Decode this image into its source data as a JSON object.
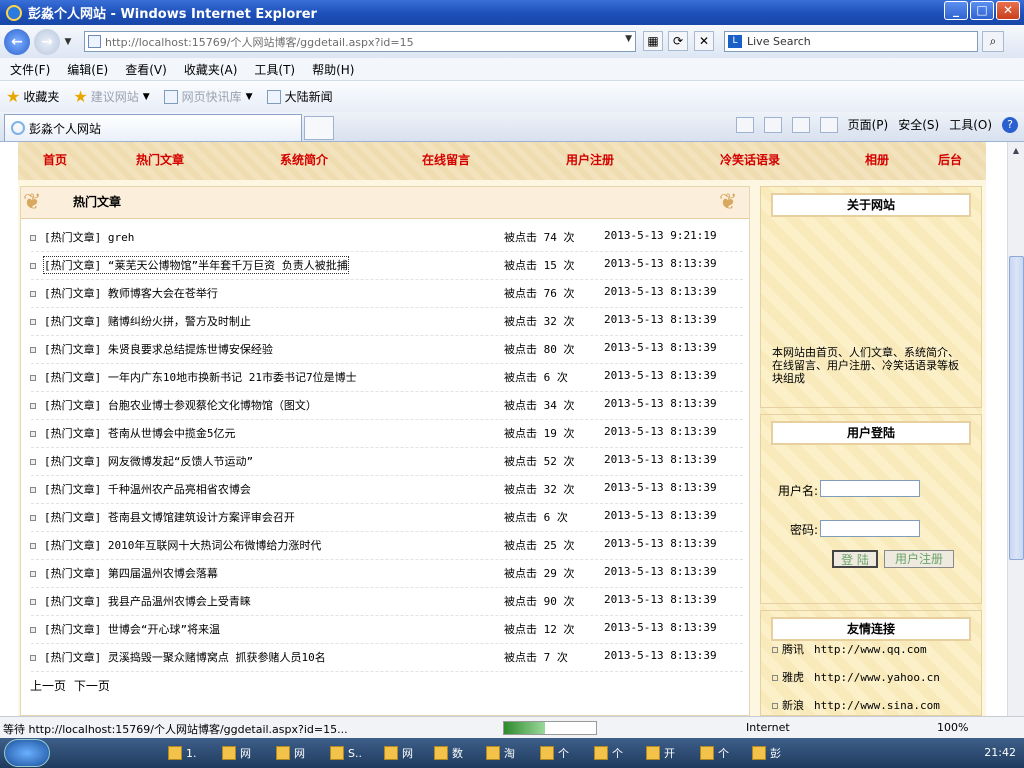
{
  "window": {
    "title": "彭淼个人网站 - Windows Internet Explorer",
    "controls": [
      "_",
      "□",
      "✕"
    ]
  },
  "address": {
    "url": "http://localhost:15769/个人网站博客/ggdetail.aspx?id=15",
    "search_placeholder": "Live Search"
  },
  "menu": [
    "文件(F)",
    "编辑(E)",
    "查看(V)",
    "收藏夹(A)",
    "工具(T)",
    "帮助(H)"
  ],
  "favbar": {
    "favorites": "收藏夹",
    "suggested": "建议网站",
    "slices": "网页快讯库",
    "news": "大陆新闻"
  },
  "tab": {
    "title": "彭淼个人网站"
  },
  "commands": {
    "page": "页面(P)",
    "safety": "安全(S)",
    "tools": "工具(O)"
  },
  "site_nav": [
    "首页",
    "热门文章",
    "系统简介",
    "在线留言",
    "用户注册",
    "冷笑话语录",
    "相册",
    "后台"
  ],
  "hot": {
    "heading": "热门文章",
    "items": [
      {
        "title": "[热门文章] greh",
        "clicks": "被点击 74 次",
        "date": "2013-5-13 9:21:19"
      },
      {
        "title": "[热门文章] “莱芜天公博物馆”半年套千万巨资 负责人被批捕",
        "clicks": "被点击 15 次",
        "date": "2013-5-13 8:13:39"
      },
      {
        "title": "[热门文章] 教师博客大会在苍举行",
        "clicks": "被点击 76 次",
        "date": "2013-5-13 8:13:39"
      },
      {
        "title": "[热门文章] 赌博纠纷火拼，警方及时制止",
        "clicks": "被点击 32 次",
        "date": "2013-5-13 8:13:39"
      },
      {
        "title": "[热门文章] 朱贤良要求总结提炼世博安保经验",
        "clicks": "被点击 80 次",
        "date": "2013-5-13 8:13:39"
      },
      {
        "title": "[热门文章] 一年内广东10地市换新书记 21市委书记7位是博士",
        "clicks": "被点击 6 次",
        "date": "2013-5-13 8:13:39"
      },
      {
        "title": "[热门文章] 台胞农业博士参观蔡伦文化博物馆（图文）",
        "clicks": "被点击 34 次",
        "date": "2013-5-13 8:13:39"
      },
      {
        "title": "[热门文章] 苍南从世博会中揽金5亿元",
        "clicks": "被点击 19 次",
        "date": "2013-5-13 8:13:39"
      },
      {
        "title": "[热门文章] 网友微博发起“反馈人节运动”",
        "clicks": "被点击 52 次",
        "date": "2013-5-13 8:13:39"
      },
      {
        "title": "[热门文章] 千种温州农产品亮相省农博会",
        "clicks": "被点击 32 次",
        "date": "2013-5-13 8:13:39"
      },
      {
        "title": "[热门文章] 苍南县文博馆建筑设计方案评审会召开",
        "clicks": "被点击 6 次",
        "date": "2013-5-13 8:13:39"
      },
      {
        "title": "[热门文章] 2010年互联网十大热词公布微博给力涨时代",
        "clicks": "被点击 25 次",
        "date": "2013-5-13 8:13:39"
      },
      {
        "title": "[热门文章] 第四届温州农博会落幕",
        "clicks": "被点击 29 次",
        "date": "2013-5-13 8:13:39"
      },
      {
        "title": "[热门文章] 我县产品温州农博会上受青睐",
        "clicks": "被点击 90 次",
        "date": "2013-5-13 8:13:39"
      },
      {
        "title": "[热门文章] 世博会“开心球”将来温",
        "clicks": "被点击 12 次",
        "date": "2013-5-13 8:13:39"
      },
      {
        "title": "[热门文章] 灵溪捣毁一聚众赌博窝点 抓获参赌人员10名",
        "clicks": "被点击 7 次",
        "date": "2013-5-13 8:13:39"
      }
    ],
    "prev": "上一页",
    "next": "下一页"
  },
  "sidebar": {
    "about_title": "关于网站",
    "about_text": "本网站由首页、人们文章、系统简介、在线留言、用户注册、冷笑话语录等板块组成",
    "login_title": "用户登陆",
    "username_label": "用户名:",
    "password_label": "密码:",
    "login_btn": "登 陆",
    "register_btn": "用户注册",
    "links_title": "友情连接",
    "links": [
      {
        "name": "腾讯",
        "url": "http://www.qq.com"
      },
      {
        "name": "雅虎",
        "url": "http://www.yahoo.cn"
      },
      {
        "name": "新浪",
        "url": "http://www.sina.com"
      }
    ]
  },
  "status": {
    "text": "等待 http://localhost:15769/个人网站博客/ggdetail.aspx?id=15...",
    "zone": "Internet",
    "zoom": "100%",
    "progress": 0.45
  },
  "taskbar": {
    "items": [
      "1.",
      "网",
      "网",
      "S..",
      "网",
      "数",
      "淘",
      "个",
      "个",
      "开",
      "个",
      "彭"
    ],
    "time": "21:42"
  }
}
